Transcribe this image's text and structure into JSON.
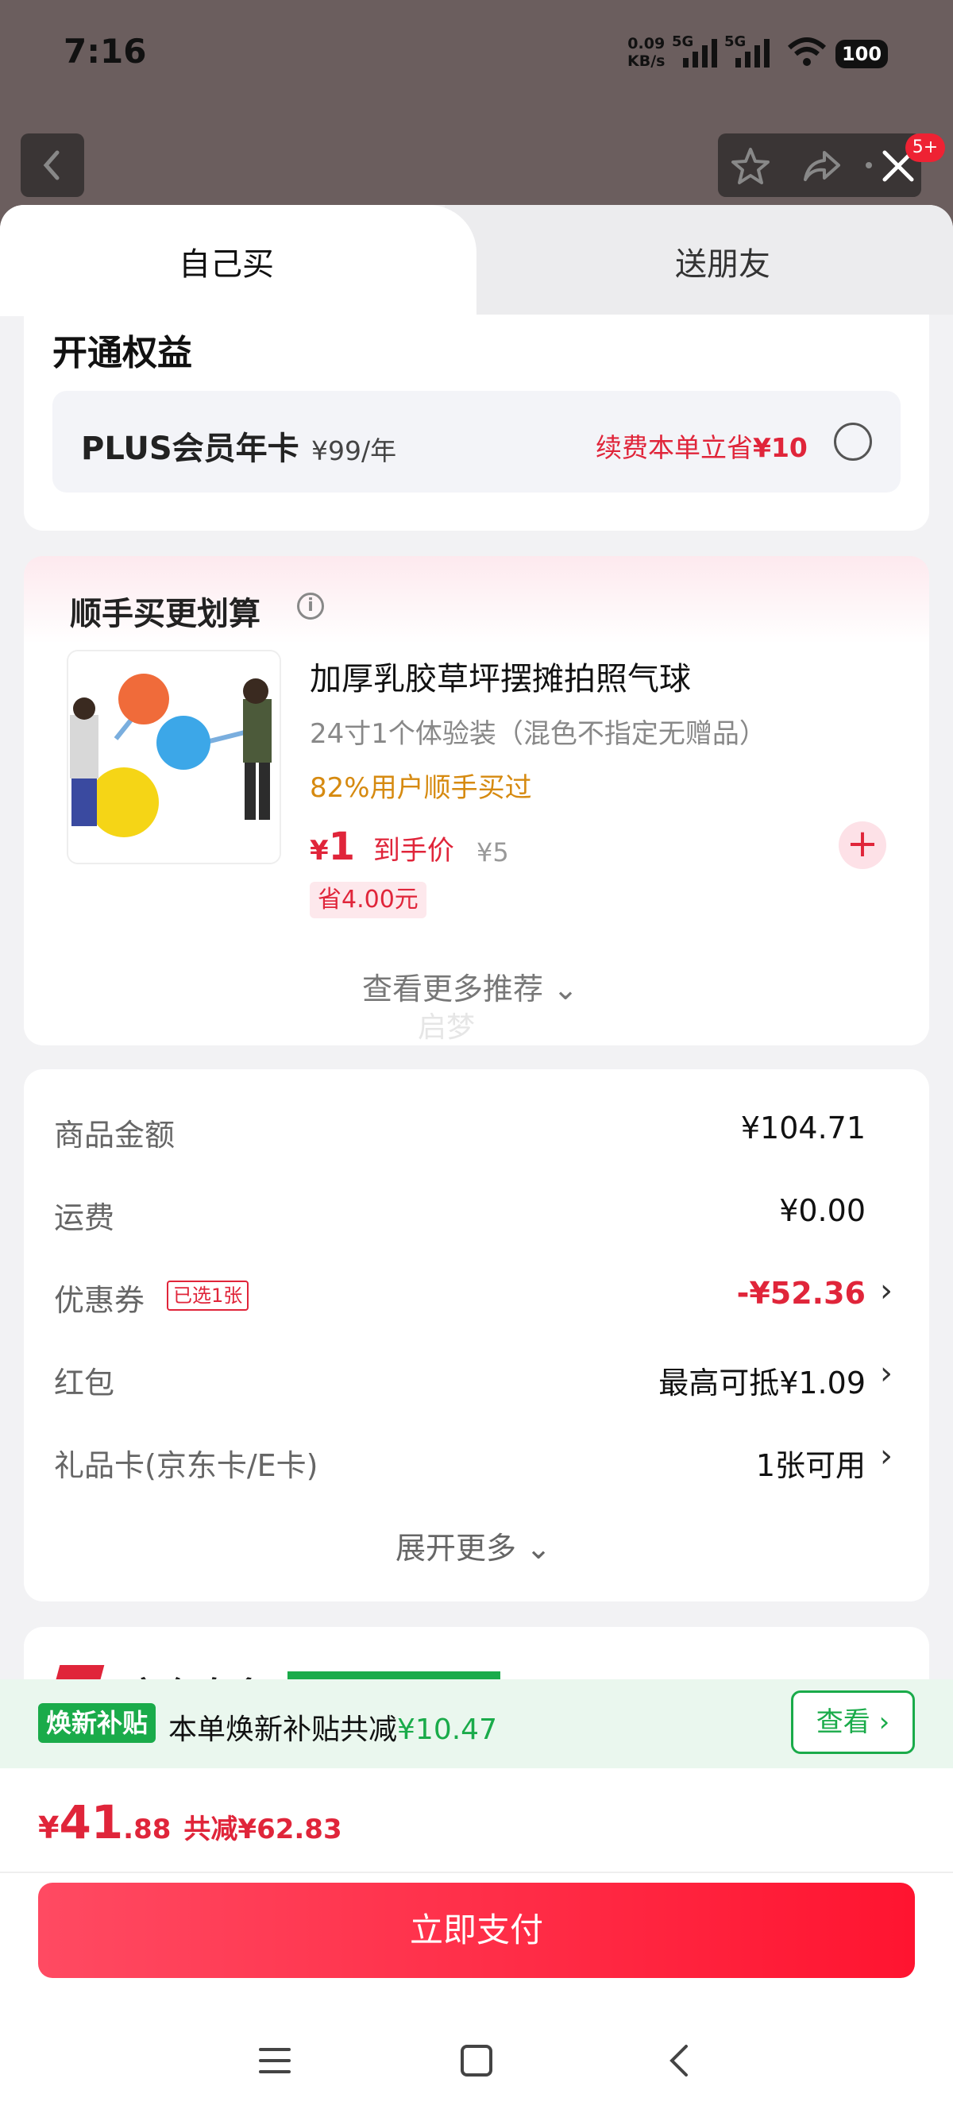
{
  "status_bar": {
    "time": "7:16",
    "net_speed_value": "0.09",
    "net_speed_unit": "KB/s",
    "sim1": "5G",
    "sim2": "5G",
    "battery": "100"
  },
  "top_nav": {
    "badge": "5+",
    "icons": [
      "back-icon",
      "star-icon",
      "share-icon",
      "more-icon",
      "close-icon"
    ]
  },
  "tabs": [
    {
      "label": "自己买",
      "active": true
    },
    {
      "label": "送朋友",
      "active": false
    }
  ],
  "benefits": {
    "title": "开通权益",
    "plus_name": "PLUS会员年卡",
    "plus_price": "¥99/年",
    "plus_save_text": "续费本单立省",
    "plus_save_amount": "¥10"
  },
  "recommend": {
    "title": "顺手买更划算",
    "product": {
      "name": "加厚乳胶草坪摆摊拍照气球",
      "spec": "24寸1个体验装（混色不指定无赠品）",
      "buyers": "82%用户顺手买过",
      "price_symbol": "¥",
      "price": "1",
      "price_label": "到手价",
      "original_price": "¥5",
      "save_tag": "省4.00元"
    },
    "more": "查看更多推荐",
    "watermark": "启梦"
  },
  "summary": {
    "rows": [
      {
        "label": "商品金额",
        "value": "¥104.71"
      },
      {
        "label": "运费",
        "value": "¥0.00"
      },
      {
        "label": "优惠券",
        "tag": "已选1张",
        "value": "-¥52.36"
      },
      {
        "label": "红包",
        "value": "最高可抵¥1.09"
      },
      {
        "label": "礼品卡(京东卡/E卡)",
        "value": "1张可用"
      }
    ],
    "expand": "展开更多"
  },
  "partial_card": {
    "text": "京东自多"
  },
  "subsidy": {
    "tag": "焕新补贴",
    "text": "本单焕新补贴共减",
    "amount": "¥10.47",
    "button": "查看 ›"
  },
  "pay": {
    "yen": "¥",
    "total_int": "41",
    "total_dec": ".88",
    "cut": "共减¥62.83",
    "button": "立即支付"
  },
  "colors": {
    "brand_red": "#e0253a",
    "subsidy_green": "#1aab4a",
    "buyers_orange": "#d68a10"
  }
}
